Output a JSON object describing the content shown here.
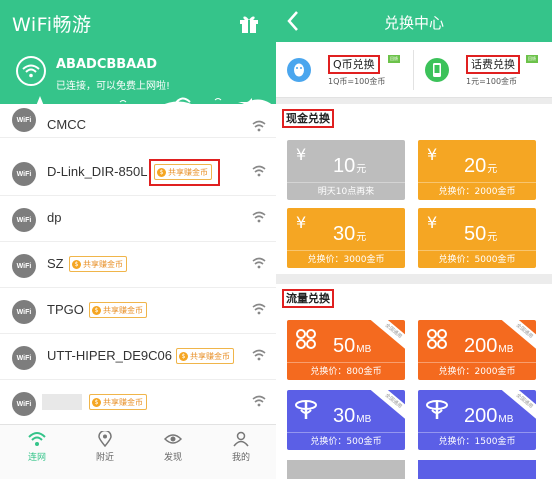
{
  "left": {
    "app_title": "WiFi畅游",
    "ssid": "ABADCBBAAD",
    "status": "已连接，可以免费上网啦!",
    "share_tag": "共享赚金币",
    "wifi_badge": "WiFi",
    "networks": [
      {
        "name": "CMCC",
        "shared": false
      },
      {
        "name": "D-Link_DIR-850L",
        "shared": true,
        "highlighted": true
      },
      {
        "name": "dp",
        "shared": false
      },
      {
        "name": "SZ",
        "shared": true
      },
      {
        "name": "TPGO",
        "shared": true
      },
      {
        "name": "UTT-HIPER_DE9C06",
        "shared": true
      },
      {
        "name": "",
        "shared": true,
        "redacted": true
      }
    ],
    "nav": [
      {
        "label": "连网",
        "icon": "wifi-icon",
        "active": true
      },
      {
        "label": "附近",
        "icon": "location-pin-icon",
        "active": false
      },
      {
        "label": "发现",
        "icon": "eye-icon",
        "active": false
      },
      {
        "label": "我的",
        "icon": "person-icon",
        "active": false
      }
    ],
    "accent_color": "#35c48a"
  },
  "right": {
    "title": "兑换中心",
    "exchange": [
      {
        "title": "Q币兑换",
        "sub": "1Q币=100金币",
        "tag": "回馈",
        "icon": "qq-penguin-icon",
        "color": "#4aa6ee"
      },
      {
        "title": "话费兑换",
        "sub": "1元=100金币",
        "tag": "回馈",
        "icon": "phone-icon",
        "color": "#3cc25a"
      }
    ],
    "cash_section": "现金兑换",
    "cash_cards": [
      {
        "amount": "10",
        "unit": "元",
        "price": "明天10点再来",
        "color": "#bdbdbd"
      },
      {
        "amount": "20",
        "unit": "元",
        "price": "兑换价：2000金币",
        "color": "#f5a623"
      },
      {
        "amount": "30",
        "unit": "元",
        "price": "兑换价：3000金币",
        "color": "#f5a623"
      },
      {
        "amount": "50",
        "unit": "元",
        "price": "兑换价：5000金币",
        "color": "#f5a623"
      }
    ],
    "flow_section": "流量兑换",
    "corner_tag": "全国通用",
    "flow_cards": [
      {
        "amount": "50",
        "unit": "MB",
        "price": "兑换价：800金币",
        "color": "#f46a1f",
        "icon": "china-unicom-icon"
      },
      {
        "amount": "200",
        "unit": "MB",
        "price": "兑换价：2000金币",
        "color": "#f46a1f",
        "icon": "china-unicom-icon"
      },
      {
        "amount": "30",
        "unit": "MB",
        "price": "兑换价：500金币",
        "color": "#5b5fe6",
        "icon": "china-telecom-icon"
      },
      {
        "amount": "200",
        "unit": "MB",
        "price": "兑换价：1500金币",
        "color": "#5b5fe6",
        "icon": "china-telecom-icon"
      }
    ]
  }
}
